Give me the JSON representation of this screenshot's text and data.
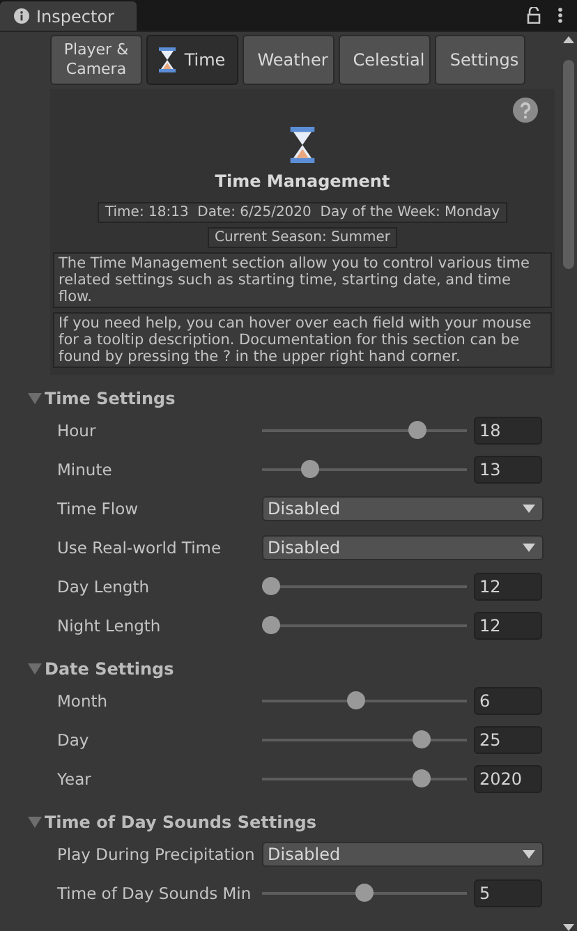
{
  "window": {
    "title": "Inspector"
  },
  "tabs": [
    {
      "label": "Player & Camera",
      "selected": false,
      "kind": "plain"
    },
    {
      "label": "Time",
      "selected": true,
      "kind": "hourglass"
    },
    {
      "label": "Weather",
      "selected": false,
      "kind": "dotted"
    },
    {
      "label": "Celestial",
      "selected": false,
      "kind": "dotted"
    },
    {
      "label": "Settings",
      "selected": false,
      "kind": "dotted"
    }
  ],
  "header": {
    "title": "Time Management",
    "status": [
      "Time: 18:13  Date: 6/25/2020  Day of the Week: Monday",
      "Current Season: Summer"
    ],
    "help": [
      "The Time Management section allow you to control various time related settings such as starting time, starting date, and time flow.",
      "If you need help, you can hover over each field with your mouse for a tooltip description. Documentation for this section can be found by pressing the ? in the upper right hand corner."
    ]
  },
  "sections": [
    {
      "title": "Time Settings",
      "expanded": true,
      "rows": [
        {
          "kind": "slider",
          "label": "Hour",
          "level": 0.76,
          "value": "18"
        },
        {
          "kind": "slider",
          "label": "Minute",
          "level": 0.24,
          "value": "13"
        },
        {
          "kind": "dropdown",
          "label": "Time Flow",
          "value": "Disabled"
        },
        {
          "kind": "dropdown",
          "label": "Use Real-world Time",
          "value": "Disabled"
        },
        {
          "kind": "slider",
          "label": "Day Length",
          "level": 0.05,
          "value": "12"
        },
        {
          "kind": "slider",
          "label": "Night Length",
          "level": 0.05,
          "value": "12"
        }
      ]
    },
    {
      "title": "Date Settings",
      "expanded": true,
      "rows": [
        {
          "kind": "slider",
          "label": "Month",
          "level": 0.46,
          "value": "6"
        },
        {
          "kind": "slider",
          "label": "Day",
          "level": 0.78,
          "value": "25"
        },
        {
          "kind": "slider",
          "label": "Year",
          "level": 0.78,
          "value": "2020"
        }
      ]
    },
    {
      "title": "Time of Day Sounds Settings",
      "expanded": true,
      "rows": [
        {
          "kind": "dropdown",
          "label": "Play During Precipitation",
          "value": "Disabled"
        },
        {
          "kind": "slider",
          "label": "Time of Day Sounds Min",
          "level": 0.5,
          "value": "5"
        }
      ]
    }
  ]
}
